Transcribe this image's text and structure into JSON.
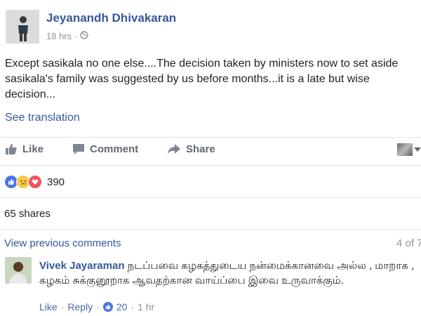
{
  "post": {
    "author": "Jeyanandh Dhivakaran",
    "time": "18 hrs",
    "separator": "·",
    "audience_icon": "globe-icon",
    "text": "Except sasikala no one else....The decision taken by ministers now to set aside sasikala's family was suggested by us before months...it is a late but wise decision...",
    "see_translation": "See translation"
  },
  "actions": {
    "like": "Like",
    "comment": "Comment",
    "share": "Share"
  },
  "reactions": {
    "icons": [
      "like-reaction-icon",
      "sad-reaction-icon",
      "love-reaction-icon"
    ],
    "count": "390"
  },
  "shares": "65 shares",
  "comments": {
    "view_previous": "View previous comments",
    "page_count": "4 of 7",
    "items": [
      {
        "author": "Vivek Jayaraman",
        "text": "நடப்பவை கழகத்துடைய நன்மைக்கானவை அல்ல , மாறாக , கழகம் சுக்குனூறாக ஆவதற்கான வாய்ப்பை இவை உருவாக்கும்.",
        "like": "Like",
        "reply": "Reply",
        "likes": "20",
        "time": "1 hr"
      }
    ]
  },
  "colors": {
    "link": "#365899",
    "meta": "#90949c",
    "like_blue": "#4a76e8",
    "love_red": "#f2545b",
    "sad_yellow": "#f7c946"
  }
}
